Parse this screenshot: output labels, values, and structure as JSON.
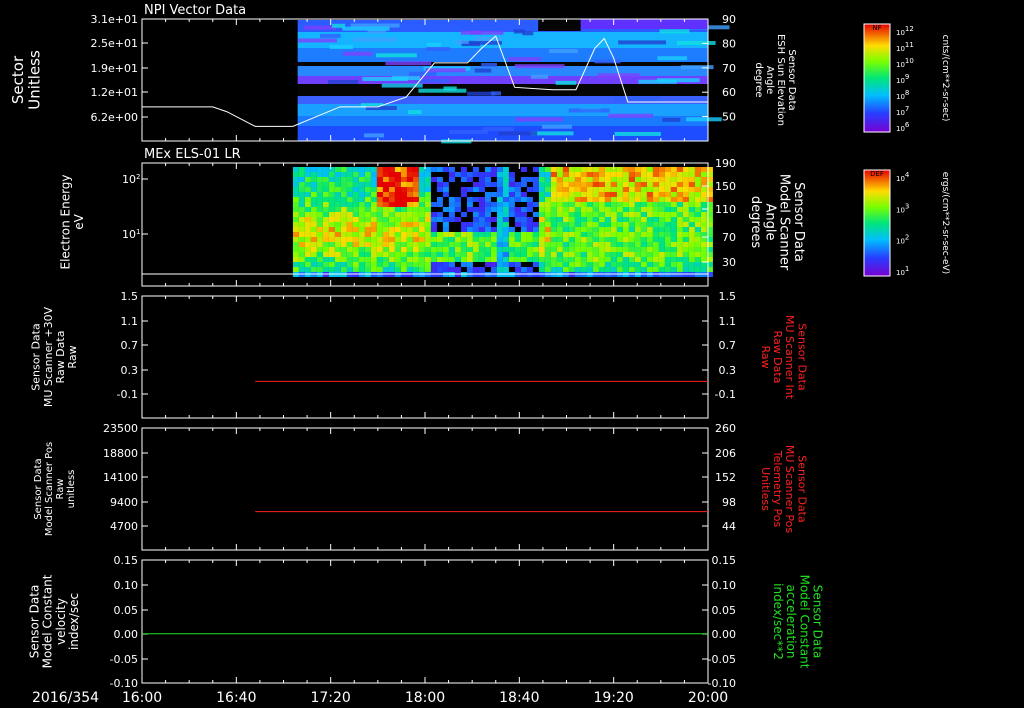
{
  "date_label": "2016/354",
  "time_ticks": [
    "16:00",
    "16:40",
    "17:20",
    "18:00",
    "18:40",
    "19:20",
    "20:00"
  ],
  "chart_data": [
    {
      "type": "heatmap",
      "title": "NPI Vector Data",
      "ylabel": "Sector Unitless",
      "ytick_labels": [
        "3.1e+01",
        "2.5e+01",
        "1.9e+01",
        "1.2e+01",
        "6.2e+00"
      ],
      "right_ylabel": "Sensor Data ESH Sun Elevation Angle degree",
      "right_ytick_labels": [
        "90",
        "80",
        "70",
        "60",
        "50"
      ],
      "right_ylim": [
        40,
        90
      ],
      "colorbar": {
        "label": "NF",
        "units": "cnts/(cm**2-sr-sec)",
        "tick_labels": [
          "10^12",
          "10^11",
          "10^10",
          "10^9",
          "10^8",
          "10^7",
          "10^6"
        ]
      },
      "series": [
        {
          "color": "#ffffff",
          "x": [
            "16:00",
            "16:30",
            "16:36",
            "16:48",
            "17:04",
            "17:14",
            "17:24",
            "17:40",
            "17:52",
            "18:04",
            "18:18",
            "18:24",
            "18:30",
            "18:38",
            "18:54",
            "19:04",
            "19:12",
            "19:16",
            "19:20",
            "19:26",
            "20:00"
          ],
          "y": [
            54,
            54,
            52,
            46,
            46,
            50,
            54,
            54,
            58,
            72,
            72,
            78,
            83,
            62,
            61,
            61,
            78,
            82,
            74,
            56,
            56
          ]
        }
      ]
    },
    {
      "type": "heatmap",
      "title": "MEx ELS-01 LR",
      "ylabel": "Electron Energy eV",
      "ytick_labels": [
        "10^2",
        "10^1"
      ],
      "right_ylabel": "Sensor Data Model Scanner Angle degrees",
      "right_ytick_labels": [
        "190",
        "150",
        "110",
        "70",
        "30"
      ],
      "colorbar": {
        "label": "DEF",
        "units": "ergs/(cm**2-sr-sec-eV)",
        "tick_labels": [
          "10^4",
          "10^3",
          "10^2",
          "10^1"
        ]
      }
    },
    {
      "type": "line",
      "ylabel": "Sensor Data MU Scanner +30V Raw Data Raw",
      "ytick_labels": [
        "1.5",
        "1.1",
        "0.7",
        "0.3",
        "-0.1"
      ],
      "ylim": [
        -0.5,
        1.5
      ],
      "right_ylabel": "Sensor Data MU Scanner Int Raw Data Raw",
      "right_ytick_labels": [
        "1.5",
        "1.1",
        "0.7",
        "0.3",
        "-0.1"
      ],
      "series": [
        {
          "color": "#ff2020",
          "x": [
            "16:48",
            "20:00"
          ],
          "y": [
            0.1,
            0.1
          ]
        }
      ]
    },
    {
      "type": "line",
      "ylabel": "Sensor Data Model Scanner Pos Raw unitless",
      "ytick_labels": [
        "23500",
        "18800",
        "14100",
        "9400",
        "4700"
      ],
      "ylim": [
        0,
        23500
      ],
      "right_ylabel": "Sensor Data MU Scanner Pos Telemetry Pos Unitless",
      "right_ytick_labels": [
        "260",
        "206",
        "152",
        "98",
        "44"
      ],
      "series": [
        {
          "color": "#ff2020",
          "x": [
            "16:48",
            "20:00"
          ],
          "y": [
            7400,
            7400
          ]
        }
      ]
    },
    {
      "type": "line",
      "ylabel": "Sensor Data Model Constant velocity index/sec",
      "ytick_labels": [
        "0.15",
        "0.10",
        "0.05",
        "0.00",
        "-0.05",
        "-0.10"
      ],
      "ylim": [
        -0.1,
        0.15
      ],
      "right_ylabel": "Sensor Data Model Constant acceleration index/sec**2",
      "right_ytick_labels": [
        "0.15",
        "0.10",
        "0.05",
        "0.00",
        "-0.05",
        "-0.10"
      ],
      "series": [
        {
          "color": "#20e020",
          "x": [
            "16:00",
            "20:00"
          ],
          "y": [
            0.0,
            0.0
          ]
        }
      ]
    }
  ]
}
